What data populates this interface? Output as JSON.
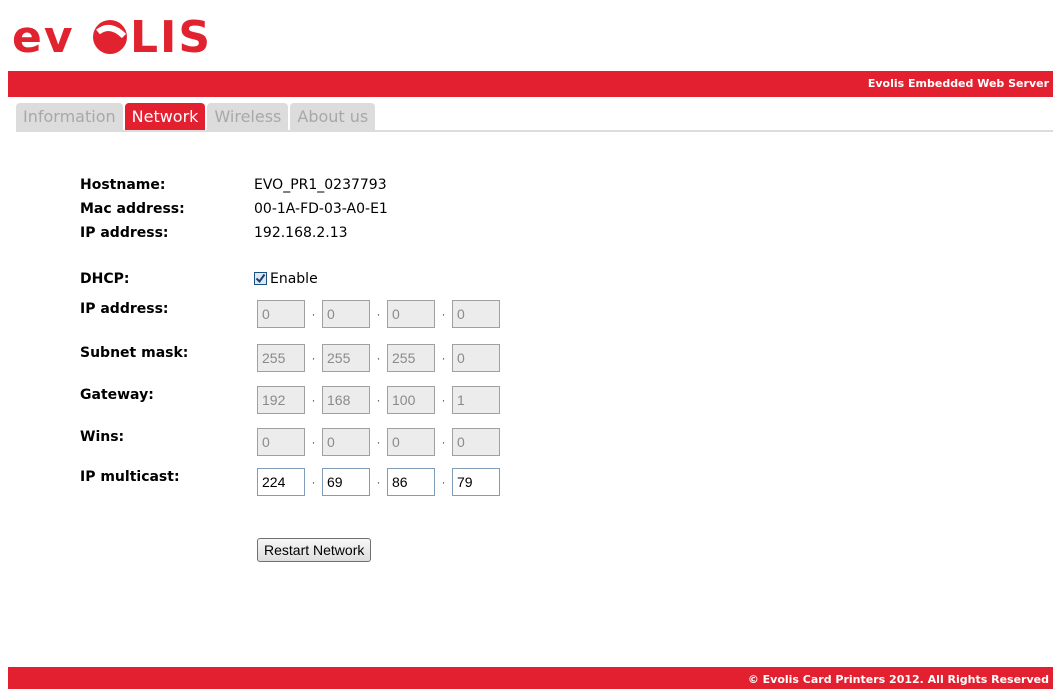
{
  "brand": {
    "logo_text": "evolis",
    "accent_color": "#e3202f"
  },
  "header": {
    "server_name": "Evolis Embedded Web Server"
  },
  "tabs": [
    {
      "label": "Information",
      "active": false
    },
    {
      "label": "Network",
      "active": true
    },
    {
      "label": "Wireless",
      "active": false
    },
    {
      "label": "About us",
      "active": false
    }
  ],
  "info": {
    "hostname_label": "Hostname:",
    "hostname": "EVO_PR1_0237793",
    "mac_label": "Mac address:",
    "mac": "00-1A-FD-03-A0-E1",
    "ip_label": "IP address:",
    "ip": "192.168.2.13"
  },
  "form": {
    "dhcp_label": "DHCP:",
    "dhcp_option": "Enable",
    "dhcp_checked": true,
    "ip_label": "IP address:",
    "ip": [
      "0",
      "0",
      "0",
      "0"
    ],
    "subnet_label": "Subnet mask:",
    "subnet": [
      "255",
      "255",
      "255",
      "0"
    ],
    "gateway_label": "Gateway:",
    "gateway": [
      "192",
      "168",
      "100",
      "1"
    ],
    "wins_label": "Wins:",
    "wins": [
      "0",
      "0",
      "0",
      "0"
    ],
    "multicast_label": "IP multicast:",
    "multicast": [
      "224",
      "69",
      "86",
      "79"
    ],
    "separator": "·"
  },
  "actions": {
    "restart_label": "Restart Network"
  },
  "footer": {
    "copyright": "© Evolis Card Printers 2012. All Rights Reserved"
  }
}
